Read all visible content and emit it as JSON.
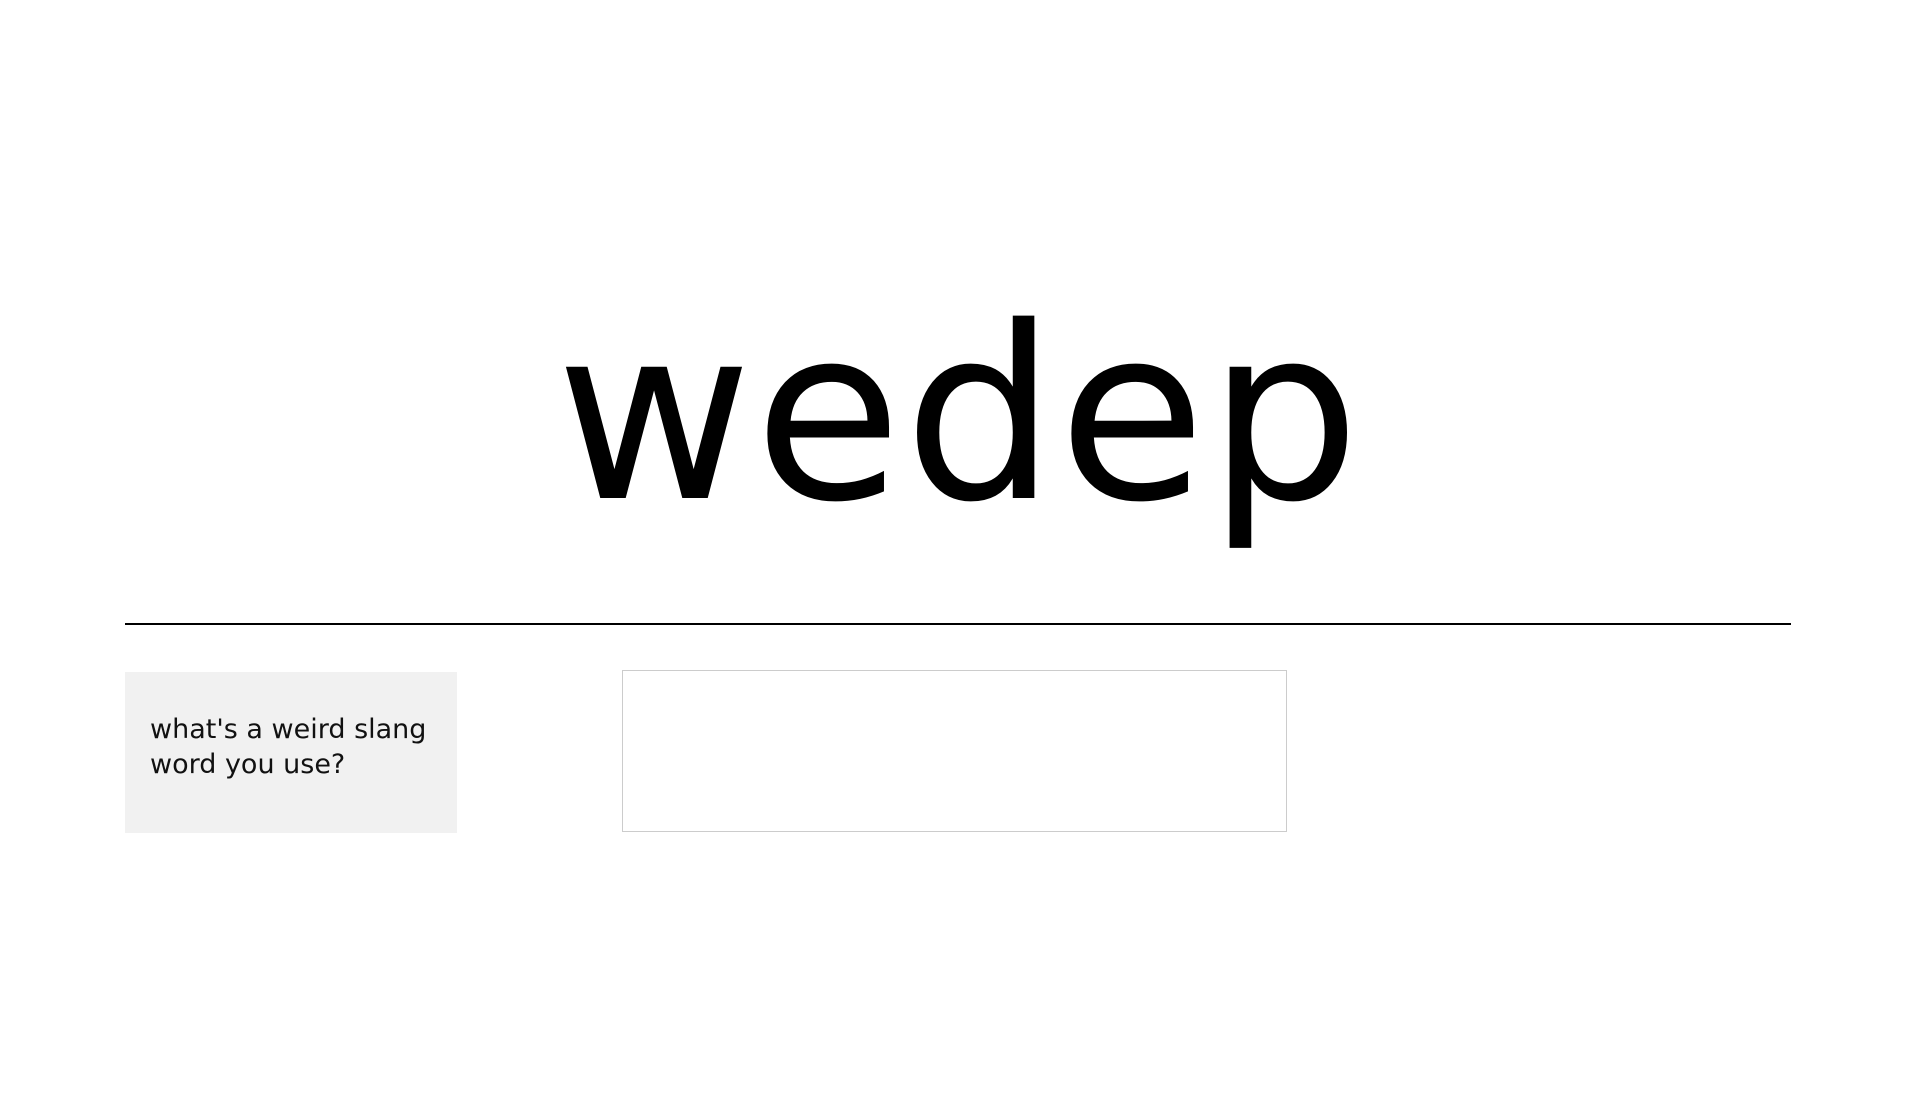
{
  "header": {
    "title": "wedep"
  },
  "prompt": {
    "question": "what's a weird slang word you use?"
  },
  "answer": {
    "value": "",
    "placeholder": ""
  }
}
